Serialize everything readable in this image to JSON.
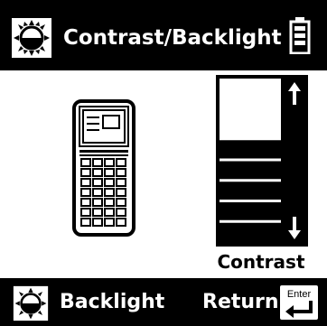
{
  "title": "Contrast/Backlight",
  "icons": {
    "title": "backlight-sun-icon",
    "battery": "battery-icon",
    "device": "handheld-device-icon",
    "up": "arrow-up-icon",
    "down": "arrow-down-icon",
    "backlight": "backlight-sun-icon",
    "enter": "enter-key-icon"
  },
  "contrast": {
    "label": "Contrast",
    "total_steps": 8,
    "filled_steps": 5
  },
  "buttons": {
    "backlight_label": "Backlight",
    "return_label": "Return",
    "enter_key_text": "Enter"
  }
}
